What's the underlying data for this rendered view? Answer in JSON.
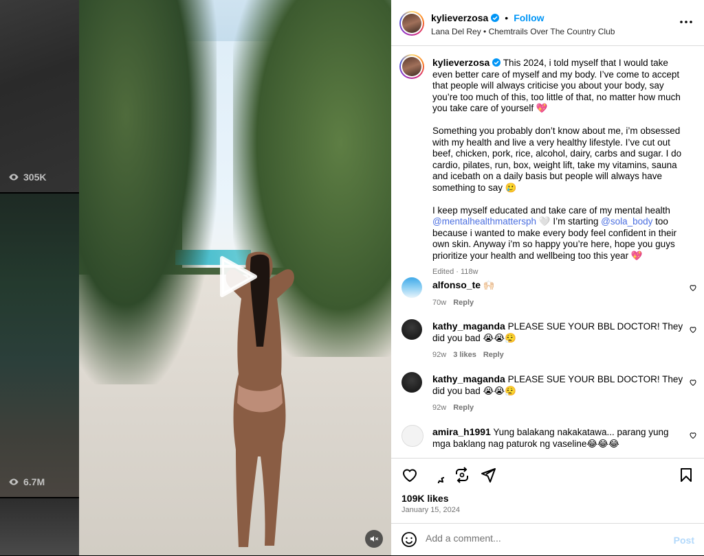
{
  "left_reels": {
    "views_top": "305K",
    "views_bottom": "6.7M"
  },
  "post": {
    "username": "kylieverzosa",
    "follow_label": "Follow",
    "audio": "Lana Del Rey • Chemtrails Over The Country Club",
    "caption_p1": "This 2024, i told myself that I would take even better care of myself and my body. I’ve come to accept that people will always criticise you about your body, say you’re too much of this, too little of that, no matter how much you take care of yourself 💖",
    "caption_p2": "Something you probably don’t know about me, i’m obsessed with my health and live a very healthy lifestyle. I’ve cut out beef, chicken, pork, rice, alcohol, dairy, carbs and sugar. I do cardio, pilates, run, box, weight lift, take my vitamins, sauna and icebath on a daily basis but people will always have something to say 🥲",
    "caption_p3_a": "I keep myself educated and take care of my mental health",
    "mention1": "@mentalhealthmattersph",
    "caption_p3_b": "🤍  I’m starting",
    "mention2": "@sola_body",
    "caption_p3_c": "too because i wanted to make every body feel confident in their own skin. Anyway i’m so happy you’re here, hope you guys prioritize your health and wellbeing too this year 💖",
    "edited": "Edited · 118w",
    "likes": "109K likes",
    "date": "January 15, 2024"
  },
  "comments": [
    {
      "user": "alfonso_te",
      "text": "🙌🏻",
      "time": "70w",
      "likes": "",
      "reply": "Reply"
    },
    {
      "user": "kathy_maganda",
      "text": "PLEASE SUE YOUR BBL DOCTOR! They did you bad 😭😭😮‍💨",
      "time": "92w",
      "likes": "3 likes",
      "reply": "Reply"
    },
    {
      "user": "kathy_maganda",
      "text": "PLEASE SUE YOUR BBL DOCTOR! They did you bad 😭😭😮‍💨",
      "time": "92w",
      "likes": "",
      "reply": "Reply"
    },
    {
      "user": "amira_h1991",
      "text": "Yung balakang nakakatawa... parang yung mga baklang nag paturok ng vaseline😂😂😂",
      "time": "",
      "likes": "",
      "reply": ""
    }
  ],
  "composer": {
    "placeholder": "Add a comment...",
    "post_label": "Post"
  },
  "colors": {
    "link": "#0095f6",
    "mention": "#4a6ee0",
    "muted": "#737373"
  }
}
